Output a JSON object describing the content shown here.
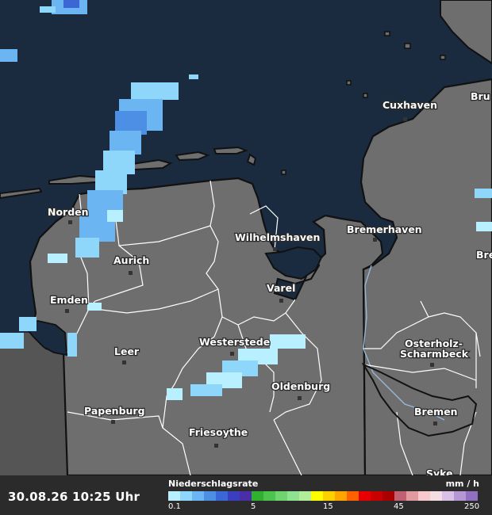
{
  "timestamp": "30.08.26 10:25 Uhr",
  "legend": {
    "title": "Niederschlagsrate",
    "unit": "mm / h",
    "ticks": [
      "0.1",
      "5",
      "15",
      "45",
      "250"
    ],
    "colors": [
      "#b9f0ff",
      "#8fd6fb",
      "#6bb6f2",
      "#4e8fe6",
      "#3a66d6",
      "#3a3fc0",
      "#4a2ea8",
      "#2fb02f",
      "#4cc34c",
      "#6fd46f",
      "#8fe28f",
      "#b2ee9a",
      "#ffff00",
      "#ffd000",
      "#ffa500",
      "#ff6000",
      "#e80000",
      "#c80000",
      "#aa0000",
      "#c06070",
      "#e09aa0",
      "#f6c9cc",
      "#f3dde2",
      "#d8c0e6",
      "#b597d3",
      "#9070c0"
    ]
  },
  "map_colors": {
    "sea": "#1a2b40",
    "land": "#6e6e6e",
    "land_west": "#5a5a5a",
    "borders": "#ffffff",
    "coast": "#111111"
  },
  "cities": [
    {
      "id": "cuxhaven",
      "name": "Cuxhaven"
    },
    {
      "id": "bremen-edge",
      "name": "Bru"
    },
    {
      "id": "norden",
      "name": "Norden"
    },
    {
      "id": "wilhelmshaven",
      "name": "Wilhelmshaven"
    },
    {
      "id": "bremerhaven",
      "name": "Bremerhaven"
    },
    {
      "id": "aurich",
      "name": "Aurich"
    },
    {
      "id": "bre-edge",
      "name": "Bre"
    },
    {
      "id": "varel",
      "name": "Varel"
    },
    {
      "id": "emden",
      "name": "Emden"
    },
    {
      "id": "leer",
      "name": "Leer"
    },
    {
      "id": "westerstede",
      "name": "Westerstede"
    },
    {
      "id": "osterholz",
      "name": "Osterholz-"
    },
    {
      "id": "scharmbeck",
      "name": "Scharmbeck"
    },
    {
      "id": "oldenburg",
      "name": "Oldenburg"
    },
    {
      "id": "bremen",
      "name": "Bremen"
    },
    {
      "id": "papenburg",
      "name": "Papenburg"
    },
    {
      "id": "friesoythe",
      "name": "Friesoythe"
    },
    {
      "id": "syke",
      "name": "Syke"
    }
  ]
}
